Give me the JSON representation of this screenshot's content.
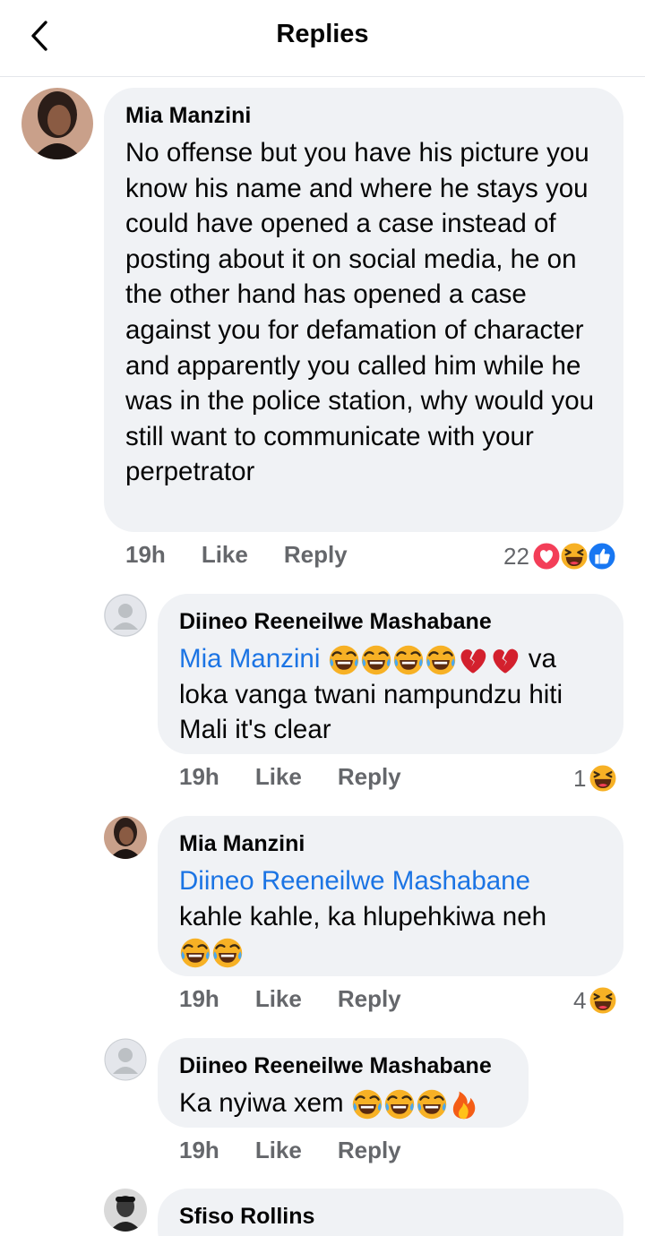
{
  "header": {
    "title": "Replies",
    "back_icon": "chevron-left-icon"
  },
  "comments": [
    {
      "author": "Mia Manzini",
      "text": "No offense but you have his picture you know his name and where he stays you could have opened a case instead of posting about it on social media, he on the other hand has opened a case against you for defamation of character and apparently you called him while he was in the police station, why would you still want to communicate with your perpetrator",
      "time": "19h",
      "like": "Like",
      "reply": "Reply",
      "reaction_count": "22",
      "reaction_icons": [
        "love-icon",
        "haha-icon",
        "like-icon"
      ]
    },
    {
      "author": "Diineo Reeneilwe Mashabane",
      "mention": "Mia Manzini",
      "text": "va loka vanga twani nampundzu hiti Mali it's clear",
      "emojis": [
        "laughing-tears-emoji",
        "laughing-tears-emoji",
        "laughing-tears-emoji",
        "laughing-tears-emoji",
        "broken-heart-emoji",
        "broken-heart-emoji"
      ],
      "time": "19h",
      "like": "Like",
      "reply": "Reply",
      "reaction_count": "1",
      "reaction_icons": [
        "haha-icon"
      ]
    },
    {
      "author": "Mia Manzini",
      "mention": "Diineo Reeneilwe Mashabane",
      "text": "kahle kahle, ka hlupehkiwa neh",
      "emojis": [
        "laughing-tears-emoji",
        "laughing-tears-emoji"
      ],
      "time": "19h",
      "like": "Like",
      "reply": "Reply",
      "reaction_count": "4",
      "reaction_icons": [
        "haha-icon"
      ]
    },
    {
      "author": "Diineo Reeneilwe Mashabane",
      "text": "Ka nyiwa xem",
      "emojis": [
        "laughing-tears-emoji",
        "laughing-tears-emoji",
        "laughing-tears-emoji",
        "fire-emoji"
      ],
      "time": "19h",
      "like": "Like",
      "reply": "Reply"
    },
    {
      "author": "Sfiso Rollins"
    }
  ],
  "colors": {
    "bubble": "#f0f2f5",
    "mention": "#1b74e4",
    "meta": "#65676b",
    "like_blue": "#1877f2",
    "love_red": "#f33e58",
    "haha_yellow": "#f7b125"
  }
}
